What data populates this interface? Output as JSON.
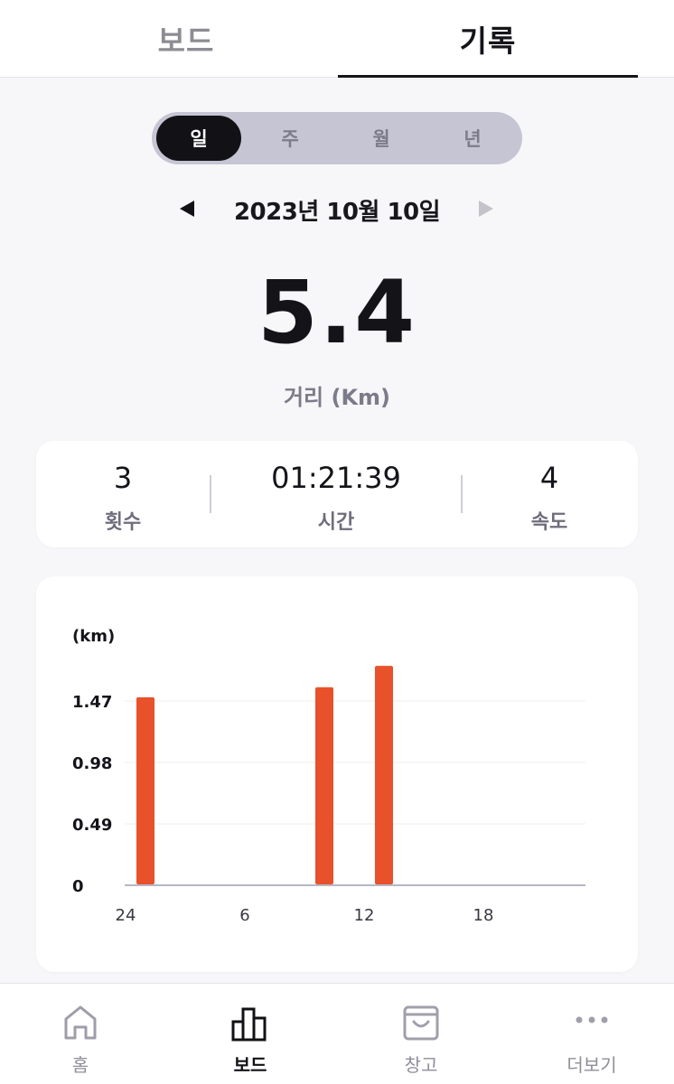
{
  "tabs": [
    {
      "label": "보드",
      "active": false
    },
    {
      "label": "기록",
      "active": true
    }
  ],
  "period": {
    "options": [
      "일",
      "주",
      "월",
      "년"
    ],
    "selected": "일"
  },
  "date_nav": {
    "date": "2023년 10월 10일",
    "prev_icon": "triangle-left-icon",
    "next_icon": "triangle-right-icon"
  },
  "summary": {
    "value": "5.4",
    "label": "거리 (Km)"
  },
  "stats": [
    {
      "value": "3",
      "label": "횟수"
    },
    {
      "value": "01:21:39",
      "label": "시간"
    },
    {
      "value": "4",
      "label": "속도"
    }
  ],
  "chart_data": {
    "type": "bar",
    "ylabel": "(km)",
    "y_ticks": [
      "0",
      "0.49",
      "0.98",
      "1.47"
    ],
    "ylim": [
      0,
      1.47
    ],
    "x_tick_labels": [
      "24",
      "6",
      "12",
      "18"
    ],
    "x_tick_hours": [
      0,
      6,
      12,
      18
    ],
    "bars": [
      {
        "hour": 1,
        "value": 1.5
      },
      {
        "hour": 10,
        "value": 1.58
      },
      {
        "hour": 13,
        "value": 1.75
      }
    ],
    "bar_color": "#e8512a",
    "grid": true
  },
  "bottom_nav": [
    {
      "label": "홈",
      "icon": "home-icon",
      "active": false
    },
    {
      "label": "보드",
      "icon": "bar-chart-icon",
      "active": true
    },
    {
      "label": "창고",
      "icon": "bag-icon",
      "active": false
    },
    {
      "label": "더보기",
      "icon": "more-dots-icon",
      "active": false
    }
  ],
  "colors": {
    "accent_bar": "#e8512a",
    "segment_bg": "#c6c5d4",
    "segment_selected": "#121116",
    "muted_text": "#7c7b89"
  }
}
